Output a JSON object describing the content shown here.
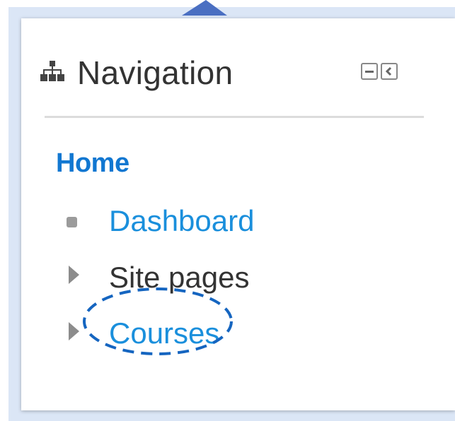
{
  "block": {
    "title": "Navigation",
    "icon": "sitemap-icon",
    "controls": {
      "collapse_icon": "minus-icon",
      "dock_icon": "chevron-left-icon"
    }
  },
  "nav": {
    "home_label": "Home",
    "items": [
      {
        "label": "Dashboard",
        "icon": "bullet-icon",
        "is_link": true
      },
      {
        "label": "Site pages",
        "icon": "expand-triangle-icon",
        "is_link": false
      },
      {
        "label": "Courses",
        "icon": "expand-triangle-icon",
        "is_link": true
      }
    ]
  },
  "colors": {
    "link": "#1a8fdc",
    "home": "#1177d1",
    "text": "#333333",
    "annotation": "#1565c0",
    "backdrop": "#dbe6f6",
    "arrow": "#4a6fc2"
  }
}
